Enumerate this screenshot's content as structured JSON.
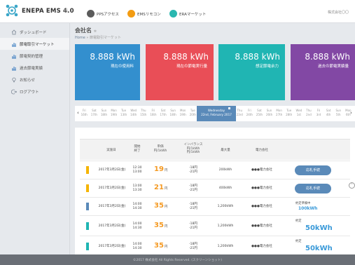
{
  "header": {
    "brand": "ENEPA EMS 4.0",
    "brand_sub": "|||",
    "nav": [
      {
        "label": "PPSアクセス",
        "color": "#5b5b5b",
        "icon": "circle-icon"
      },
      {
        "label": "EMSリモコン",
        "color": "#f39c12",
        "icon": "circle-icon"
      },
      {
        "label": "ERAマーケット",
        "color": "#2ab7b0",
        "icon": "circle-icon"
      }
    ],
    "company": "株式会社〇〇"
  },
  "sidebar": {
    "items": [
      {
        "label": "ダッシュボード",
        "icon": "home-icon",
        "active": false
      },
      {
        "label": "節電取引マーケット",
        "icon": "chart-icon",
        "active": true
      },
      {
        "label": "節電契約管理",
        "icon": "chart-icon",
        "active": false
      },
      {
        "label": "過去節電実績",
        "icon": "chart-icon",
        "active": false
      },
      {
        "label": "お知らせ",
        "icon": "bulb-icon",
        "active": false
      },
      {
        "label": "ログアウト",
        "icon": "logout-icon",
        "active": false
      }
    ]
  },
  "page": {
    "title": "会社名",
    "breadcrumb_home": "Home",
    "breadcrumb_sep": "»",
    "breadcrumb_current": "節電取引マーケット"
  },
  "tiles": [
    {
      "value": "8.888 kWh",
      "label": "現在の使用料",
      "color": "#338fce"
    },
    {
      "value": "8.888 kWh",
      "label": "現在の節電実行量",
      "color": "#e94e57"
    },
    {
      "value": "8.888 kWh",
      "label": "想定節電余力",
      "color": "#20b5b3"
    },
    {
      "value": "8.888 kWh",
      "label": "過去の節電実績量",
      "color": "#8248a4"
    }
  ],
  "calendar": {
    "left_days": [
      [
        "Fri",
        "16th"
      ],
      [
        "Sat",
        "17th"
      ],
      [
        "Sun",
        "18th"
      ],
      [
        "Mon",
        "19th"
      ],
      [
        "Tue",
        "13th"
      ],
      [
        "Wed",
        "14th"
      ],
      [
        "Thu",
        "15th"
      ],
      [
        "Fri",
        "16th"
      ],
      [
        "Sat",
        "17th"
      ],
      [
        "Sun",
        "18th"
      ],
      [
        "Mon",
        "19th"
      ],
      [
        "Tue",
        "20th"
      ]
    ],
    "selected_line1": "Wednesday",
    "selected_line2": "22nd, February 2017",
    "right_days": [
      [
        "Thu",
        "23rd"
      ],
      [
        "Fri",
        "24th"
      ],
      [
        "Sat",
        "25th"
      ],
      [
        "Sun",
        "26th"
      ],
      [
        "Mon",
        "27th"
      ],
      [
        "Tue",
        "28th"
      ],
      [
        "Wed",
        "1st"
      ],
      [
        "Thu",
        "2nd"
      ],
      [
        "Fri",
        "3rd"
      ],
      [
        "Sat",
        "4th"
      ],
      [
        "Sun",
        "5th"
      ],
      [
        "Mon",
        "6th"
      ]
    ],
    "prev": "‹",
    "next": "›"
  },
  "table": {
    "headers": {
      "date": "実施日",
      "time_l1": "開始",
      "time_l2": "終了",
      "price_l1": "単価",
      "price_l2": "円/1kWh",
      "imb_l1": "インバランス",
      "imb_l2": "円/1kWh",
      "imb_l3": "円/1kWh",
      "max_l1": "最大量",
      "company": "電力会社"
    },
    "rows": [
      {
        "bar": "#f5b400",
        "date": "2017年3月2日(金)",
        "start": "12:30",
        "end": "13:00",
        "price": "19",
        "unit": "円",
        "imb1": "-18円",
        "imb2": "-21円",
        "max": "200kWh",
        "company": "●●●電力会社",
        "action": "button",
        "action_label": "応札手続"
      },
      {
        "bar": "#f5b400",
        "date": "2017年3月2日(金)",
        "start": "13:00",
        "end": "13:30",
        "price": "21",
        "unit": "円",
        "imb1": "-18円",
        "imb2": "-21円",
        "max": "400kWh",
        "company": "●●●電力会社",
        "action": "button",
        "action_label": "応札手続"
      },
      {
        "bar": "#5a8ab9",
        "date": "2017年3月2日(金)",
        "start": "14:00",
        "end": "14:30",
        "price": "35",
        "unit": "円",
        "imb1": "-18円",
        "imb2": "-21円",
        "max": "1,200kWh",
        "company": "●●●電力会社",
        "action": "status",
        "status_label": "約定準備中",
        "status_value": "100kWh"
      },
      {
        "bar": "#20b5b3",
        "date": "2017年3月2日(金)",
        "start": "14:00",
        "end": "14:30",
        "price": "35",
        "unit": "円",
        "imb1": "-18円",
        "imb2": "-21円",
        "max": "1,200kWh",
        "company": "●●●電力会社",
        "action": "status",
        "status_label": "約定",
        "status_value": "50kWh"
      },
      {
        "bar": "#20b5b3",
        "date": "2017年3月2日(金)",
        "start": "14:00",
        "end": "14:30",
        "price": "35",
        "unit": "円",
        "imb1": "-18円",
        "imb2": "-21円",
        "max": "1,200kWh",
        "company": "●●●電力会社",
        "action": "status",
        "status_label": "約定",
        "status_value": "50kWh"
      }
    ]
  },
  "pager": {
    "prev": "‹",
    "pages": [
      "1",
      "2",
      "3",
      "4",
      "5",
      "6"
    ],
    "next": "›"
  },
  "footer": "©2017 株式会社 All Rights Reserved. (スクリーンショット)"
}
